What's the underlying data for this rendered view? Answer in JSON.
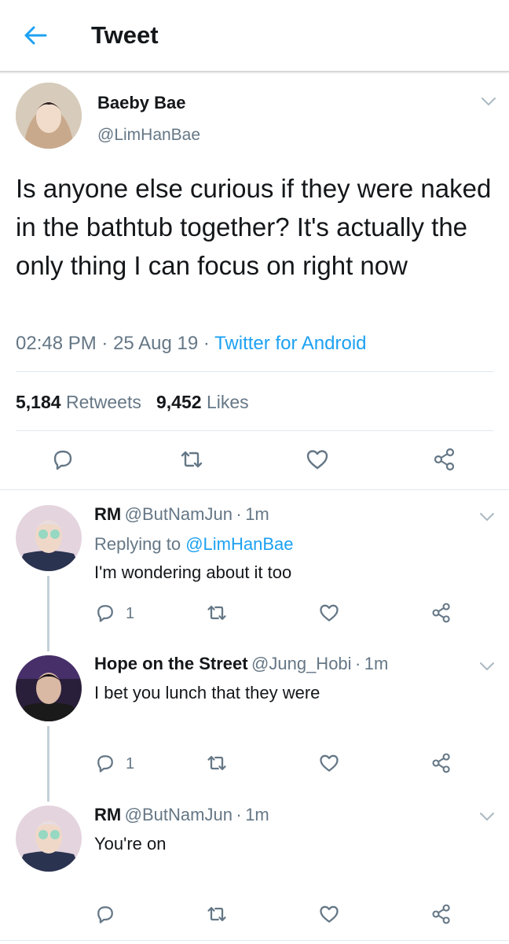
{
  "header": {
    "title": "Tweet"
  },
  "tweet": {
    "name": "Baeby Bae",
    "handle": "@LimHanBae",
    "text": "Is anyone else curious if they were naked in the bathtub together? It's actually the only thing I can focus on right now",
    "time": "02:48 PM",
    "date": "25 Aug 19",
    "source": "Twitter for Android",
    "sep": "·",
    "retweets": "5,184",
    "retweets_label": "Retweets",
    "likes": "9,452",
    "likes_label": "Likes"
  },
  "replies": [
    {
      "name": "RM",
      "handle": "@ButNamJun",
      "time": "1m",
      "replying_label": "Replying to",
      "replying_to": "@LimHanBae",
      "text": "I'm wondering about it too",
      "reply_count": "1"
    },
    {
      "name": "Hope on the Street",
      "handle": "@Jung_Hobi",
      "time": "1m",
      "text": "I bet you lunch that they were",
      "reply_count": "1"
    },
    {
      "name": "RM",
      "handle": "@ButNamJun",
      "time": "1m",
      "text": "You're on"
    }
  ],
  "colors": {
    "accent": "#1da1f2",
    "muted": "#657786",
    "text": "#14171a",
    "divider": "#e1e8ed"
  },
  "icons": [
    "back-arrow-icon",
    "chevron-down-icon",
    "reply-icon",
    "retweet-icon",
    "like-icon",
    "share-icon"
  ]
}
